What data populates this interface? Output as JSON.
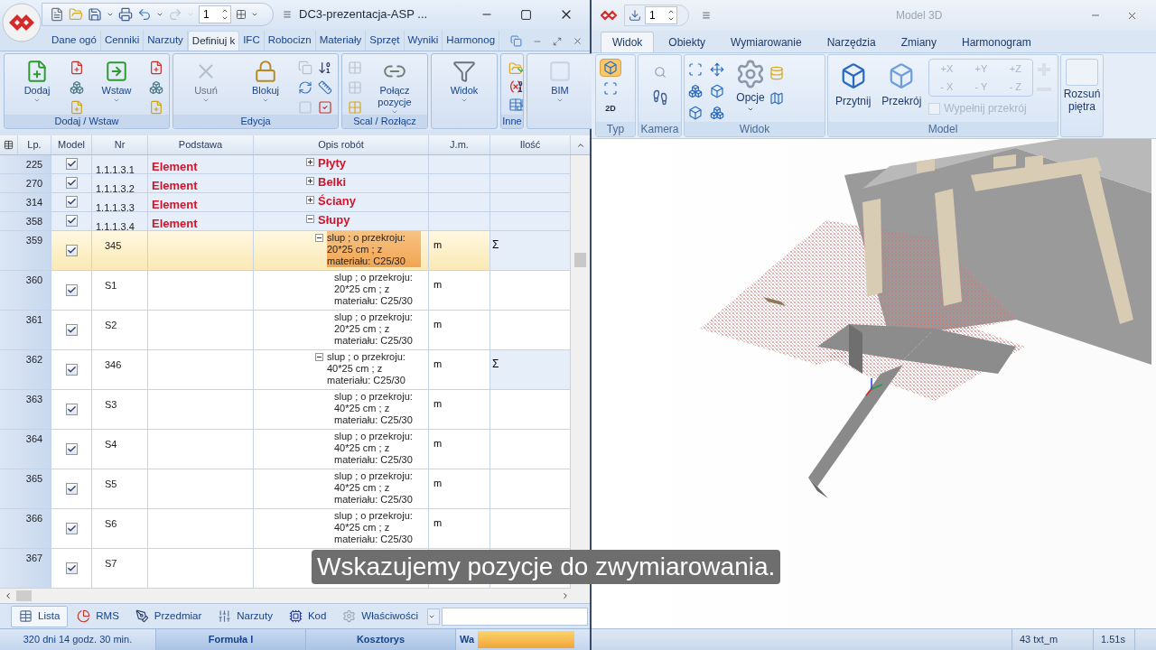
{
  "left_window": {
    "title": "DC3-prezentacja-ASP ...",
    "page_spinner": "1",
    "tabs": [
      {
        "label": "Dane ogó",
        "selected": false
      },
      {
        "label": "Cenniki",
        "selected": false
      },
      {
        "label": "Narzuty",
        "selected": false
      },
      {
        "label": "Definiuj k",
        "selected": true
      },
      {
        "label": "IFC",
        "selected": false
      },
      {
        "label": "Robocizn",
        "selected": false
      },
      {
        "label": "Materiały",
        "selected": false
      },
      {
        "label": "Sprzęt",
        "selected": false
      },
      {
        "label": "Wyniki",
        "selected": false
      },
      {
        "label": "Harmonog",
        "selected": false
      }
    ],
    "ribbon_groups": [
      {
        "label": "Dodaj / Wstaw",
        "buttons": [
          {
            "label": "Dodaj",
            "disabled": false
          },
          {
            "label": "Wstaw",
            "disabled": false
          }
        ]
      },
      {
        "label": "Edycja",
        "buttons": [
          {
            "label": "Usuń",
            "disabled": true
          },
          {
            "label": "Blokuj",
            "disabled": false
          }
        ]
      },
      {
        "label": "Scal / Rozłącz",
        "buttons": [
          {
            "label": "Połącz pozycje",
            "disabled": false
          }
        ]
      },
      {
        "buttons": [
          {
            "label": "Widok",
            "disabled": false
          }
        ]
      },
      {
        "label": "Inne"
      },
      {
        "buttons": [
          {
            "label": "BIM",
            "disabled": false
          }
        ]
      }
    ],
    "table": {
      "columns": [
        "Lp.",
        "Model",
        "Nr",
        "Podstawa",
        "Opis robót",
        "J.m.",
        "Ilość"
      ],
      "rows": [
        {
          "kind": "element",
          "lp": "225",
          "in_model": true,
          "nr": "1.1.1.3.1",
          "podstawa": "Element",
          "opis": "Płyty",
          "expanded": false,
          "selected": false
        },
        {
          "kind": "element",
          "lp": "270",
          "in_model": true,
          "nr": "1.1.1.3.2",
          "podstawa": "Element",
          "opis": "Belki",
          "expanded": false,
          "selected": false
        },
        {
          "kind": "element",
          "lp": "314",
          "in_model": true,
          "nr": "1.1.1.3.3",
          "podstawa": "Element",
          "opis": "Ściany",
          "expanded": false,
          "selected": false
        },
        {
          "kind": "element",
          "lp": "358",
          "in_model": true,
          "nr": "1.1.1.3.4",
          "podstawa": "Element",
          "opis": "Słupy",
          "expanded": true,
          "selected": false,
          "children": [
            {
              "kind": "position",
              "lp": "359",
              "in_model": true,
              "nr": "345",
              "opis": "slup ; o przekroju: 20*25 cm ; z materiału: C25/30",
              "jm": "m",
              "ilosc": "Σ",
              "expanded": true,
              "selected": true,
              "children": [
                {
                  "kind": "position",
                  "lp": "360",
                  "in_model": true,
                  "nr": "S1",
                  "opis": "slup ; o przekroju: 20*25 cm ; z materiału: C25/30",
                  "jm": "m",
                  "selected": false
                },
                {
                  "kind": "position",
                  "lp": "361",
                  "in_model": true,
                  "nr": "S2",
                  "opis": "slup ; o przekroju: 20*25 cm ; z materiału: C25/30",
                  "jm": "m",
                  "selected": false
                }
              ]
            },
            {
              "kind": "position",
              "lp": "362",
              "in_model": true,
              "nr": "346",
              "opis": "slup ; o przekroju: 40*25 cm ; z materiału: C25/30",
              "jm": "m",
              "ilosc": "Σ",
              "expanded": true,
              "selected": false,
              "children": [
                {
                  "kind": "position",
                  "lp": "363",
                  "in_model": true,
                  "nr": "S3",
                  "opis": "slup ; o przekroju: 40*25 cm ; z materiału: C25/30",
                  "jm": "m",
                  "selected": false
                },
                {
                  "kind": "position",
                  "lp": "364",
                  "in_model": true,
                  "nr": "S4",
                  "opis": "slup ; o przekroju: 40*25 cm ; z materiału: C25/30",
                  "jm": "m",
                  "selected": false
                },
                {
                  "kind": "position",
                  "lp": "365",
                  "in_model": true,
                  "nr": "S5",
                  "opis": "slup ; o przekroju: 40*25 cm ; z materiału: C25/30",
                  "jm": "m",
                  "selected": false
                },
                {
                  "kind": "position",
                  "lp": "366",
                  "in_model": true,
                  "nr": "S6",
                  "opis": "slup ; o przekroju: 40*25 cm ; z materiału: C25/30",
                  "jm": "m",
                  "selected": false
                },
                {
                  "kind": "position",
                  "lp": "367",
                  "in_model": true,
                  "nr": "S7",
                  "selected": false
                }
              ]
            }
          ]
        }
      ]
    },
    "bottom_tabs": [
      {
        "label": "Lista",
        "selected": true
      },
      {
        "label": "RMS",
        "selected": false
      },
      {
        "label": "Przedmiar",
        "selected": false
      },
      {
        "label": "Narzuty",
        "selected": false
      },
      {
        "label": "Kod",
        "selected": false
      },
      {
        "label": "Właściwości",
        "selected": false
      }
    ],
    "status_bar": {
      "time": "320 dni 14 godz. 30 min.",
      "panels": [
        "Formuła I",
        "Kosztorys"
      ],
      "short_label": "Wa",
      "progress": {
        "level": 1
      }
    }
  },
  "right_window": {
    "title": "Model 3D",
    "page_spinner": "1",
    "tabs": [
      {
        "label": "Widok",
        "selected": true
      },
      {
        "label": "Obiekty",
        "selected": false
      },
      {
        "label": "Wymiarowanie",
        "selected": false
      },
      {
        "label": "Narzędzia",
        "selected": false
      },
      {
        "label": "Zmiany",
        "selected": false
      },
      {
        "label": "Harmonogram",
        "selected": false
      }
    ],
    "view_modes": [
      {
        "kind": "solid",
        "selected": true
      },
      {
        "kind": "wire",
        "selected": false
      },
      {
        "kind": "flat",
        "label": "2D",
        "selected": false
      }
    ],
    "groups": {
      "typ": "Typ",
      "kamera": "Kamera",
      "widok": "Widok",
      "model": "Model"
    },
    "options_button": "Opcje",
    "model_buttons": [
      "Przytnij",
      "Przekrój"
    ],
    "axis_buttons": [
      {
        "label": "+X",
        "disabled": true
      },
      {
        "label": "+Y",
        "disabled": true
      },
      {
        "label": "+Z",
        "disabled": true
      },
      {
        "label": "- X",
        "disabled": true
      },
      {
        "label": "- Y",
        "disabled": true
      },
      {
        "label": "- Z",
        "disabled": true
      }
    ],
    "fill_section": {
      "label": "Wypełnij przekrój",
      "checked": false,
      "disabled": true
    },
    "floors_button": "Rozsuń piętra",
    "status_bar": {
      "count": "43 txt_m",
      "time": "1.51s"
    }
  },
  "caption": "Wskazujemy pozycje do zwymiarowania."
}
